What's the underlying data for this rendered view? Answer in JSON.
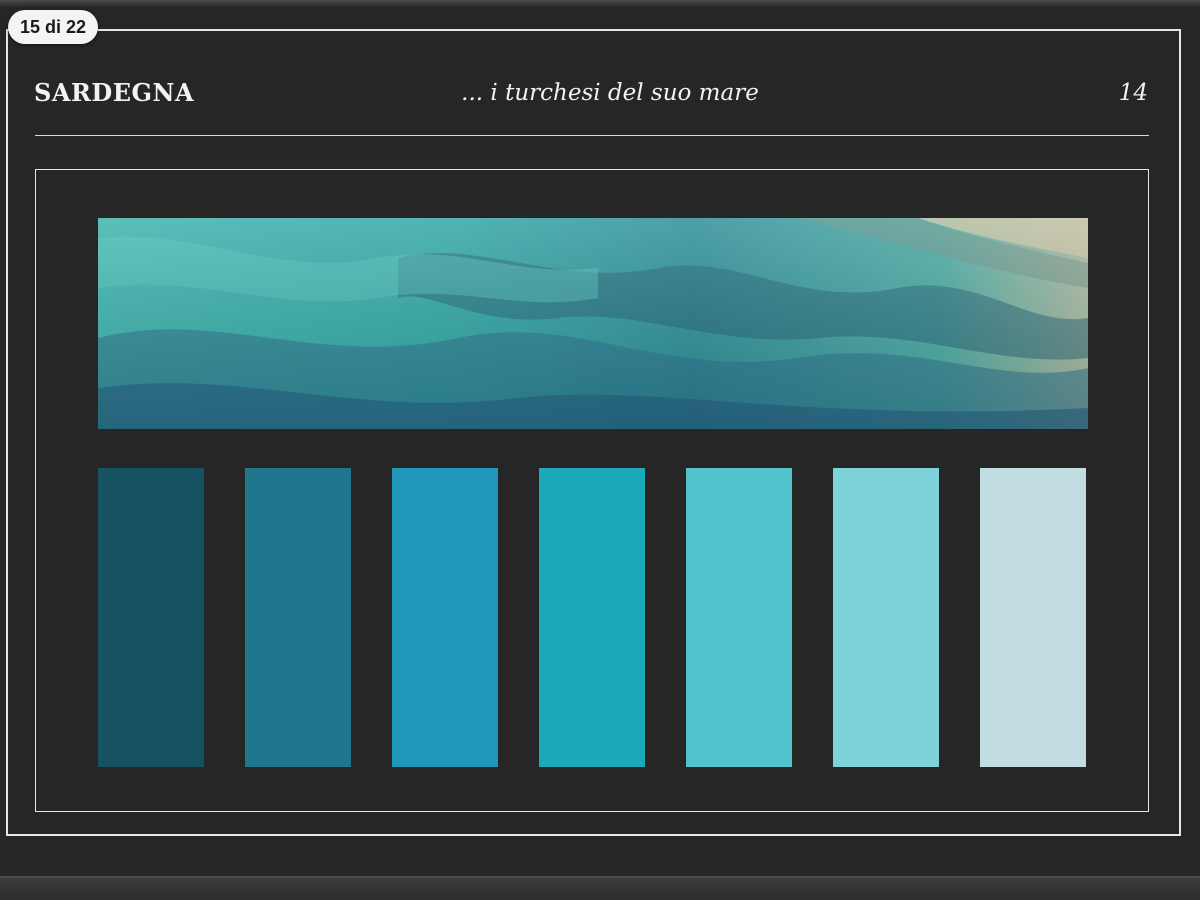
{
  "badge": {
    "page_counter": "15 di 22"
  },
  "header": {
    "title": "SARDEGNA",
    "subtitle": "... i turchesi del suo mare",
    "page_number": "14"
  },
  "photo": {
    "subject": "turquoise-sea-water"
  },
  "palette": {
    "swatches": [
      {
        "color": "#155262"
      },
      {
        "color": "#1f768d"
      },
      {
        "color": "#2096bb"
      },
      {
        "color": "#1ba8b8"
      },
      {
        "color": "#51c3cc"
      },
      {
        "color": "#7ed3da"
      },
      {
        "color": "#c2dde2"
      }
    ]
  },
  "colors": {
    "background": "#262626",
    "frame": "#e6e6e6",
    "text": "#f2f2f2"
  }
}
